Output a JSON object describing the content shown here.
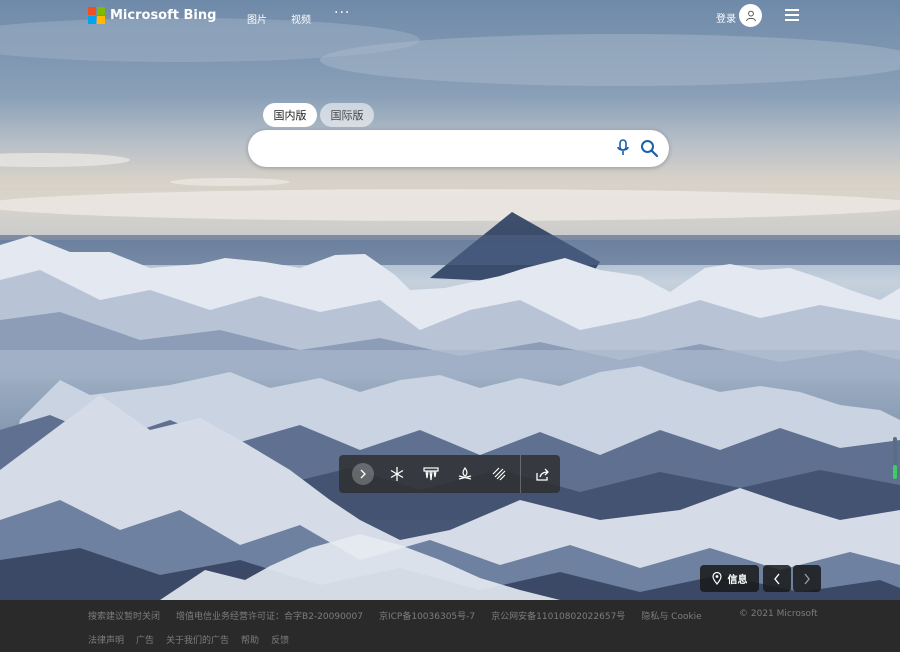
{
  "header": {
    "brand": "Microsoft Bing",
    "nav": [
      "图片",
      "视频",
      "···"
    ],
    "signin": "登录"
  },
  "search": {
    "tabs": [
      "国内版",
      "国际版"
    ],
    "active_tab": "国内版",
    "value": "",
    "placeholder": ""
  },
  "toolbar": {
    "icons": [
      "chevron-right-icon",
      "snowflake-icon",
      "ice-icon",
      "campfire-icon",
      "snowfall-icon",
      "share-icon"
    ]
  },
  "image_controls": {
    "info_label": "信息"
  },
  "footer": {
    "row1": [
      "搜索建议暂时关闭",
      "增值电信业务经营许可证：合字B2-20090007",
      "京ICP备10036305号-7",
      "京公网安备11010802022657号",
      "隐私与 Cookie"
    ],
    "copyright": "© 2021 Microsoft",
    "row2": [
      "法律声明",
      "广告",
      "关于我们的广告",
      "帮助",
      "反馈"
    ]
  },
  "colors": {
    "ms_red": "#f25022",
    "ms_green": "#7fba00",
    "ms_blue": "#00a4ef",
    "ms_yellow": "#ffb900",
    "search_icon": "#1a5fa8",
    "footer_bg": "#2a2a2a"
  }
}
